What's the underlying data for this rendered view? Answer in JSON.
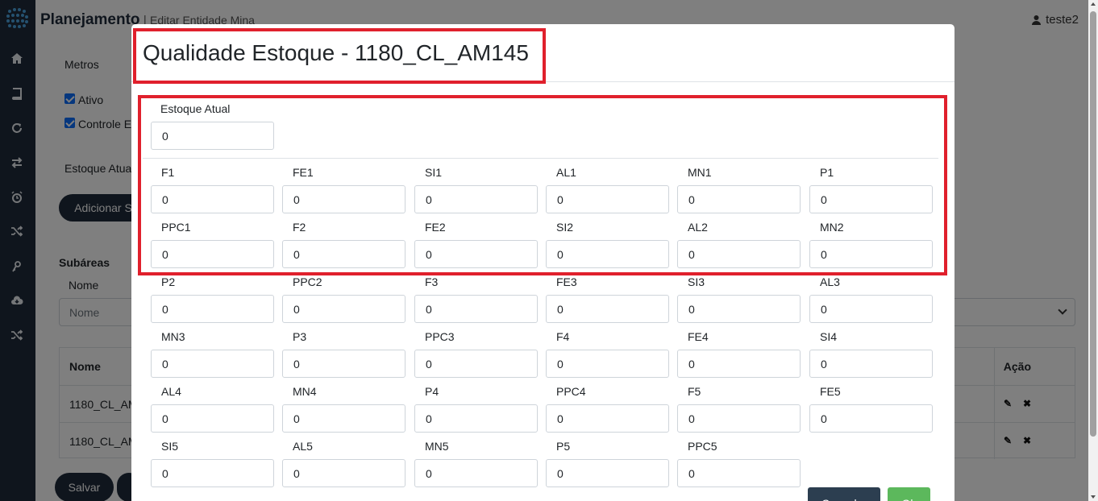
{
  "header": {
    "app_title": "Planejamento",
    "separator": "|",
    "breadcrumb": "Editar Entidade Mina",
    "user": "teste2"
  },
  "sidebar": {
    "icons": [
      "home-icon",
      "book-icon",
      "refresh-icon",
      "exchange-icon",
      "alarm-icon",
      "shuffle-icon",
      "key-icon",
      "cloud-download-icon",
      "random-icon"
    ]
  },
  "background": {
    "metros_label": "Metros",
    "ativo_label": "Ativo",
    "controle_label": "Controle E",
    "estoque_label": "Estoque Atua",
    "add_button": "Adicionar S",
    "subareas_heading": "Subáreas",
    "nome_label": "Nome",
    "nome_placeholder": "Nome",
    "table_header_nome": "Nome",
    "table_header_acao": "Ação",
    "rows": [
      "1180_CL_AM",
      "1180_CL_AM"
    ],
    "save_button": "Salvar"
  },
  "modal": {
    "title": "Qualidade Estoque - 1180_CL_AM145",
    "estoque_atual": {
      "label": "Estoque Atual",
      "value": "0"
    },
    "fields": [
      {
        "label": "F1",
        "value": "0"
      },
      {
        "label": "FE1",
        "value": "0"
      },
      {
        "label": "SI1",
        "value": "0"
      },
      {
        "label": "AL1",
        "value": "0"
      },
      {
        "label": "MN1",
        "value": "0"
      },
      {
        "label": "P1",
        "value": "0"
      },
      {
        "label": "PPC1",
        "value": "0"
      },
      {
        "label": "F2",
        "value": "0"
      },
      {
        "label": "FE2",
        "value": "0"
      },
      {
        "label": "SI2",
        "value": "0"
      },
      {
        "label": "AL2",
        "value": "0"
      },
      {
        "label": "MN2",
        "value": "0"
      },
      {
        "label": "P2",
        "value": "0"
      },
      {
        "label": "PPC2",
        "value": "0"
      },
      {
        "label": "F3",
        "value": "0"
      },
      {
        "label": "FE3",
        "value": "0"
      },
      {
        "label": "SI3",
        "value": "0"
      },
      {
        "label": "AL3",
        "value": "0"
      },
      {
        "label": "MN3",
        "value": "0"
      },
      {
        "label": "P3",
        "value": "0"
      },
      {
        "label": "PPC3",
        "value": "0"
      },
      {
        "label": "F4",
        "value": "0"
      },
      {
        "label": "FE4",
        "value": "0"
      },
      {
        "label": "SI4",
        "value": "0"
      },
      {
        "label": "AL4",
        "value": "0"
      },
      {
        "label": "MN4",
        "value": "0"
      },
      {
        "label": "P4",
        "value": "0"
      },
      {
        "label": "PPC4",
        "value": "0"
      },
      {
        "label": "F5",
        "value": "0"
      },
      {
        "label": "FE5",
        "value": "0"
      },
      {
        "label": "SI5",
        "value": "0"
      },
      {
        "label": "AL5",
        "value": "0"
      },
      {
        "label": "MN5",
        "value": "0"
      },
      {
        "label": "P5",
        "value": "0"
      },
      {
        "label": "PPC5",
        "value": "0"
      }
    ],
    "cancel_button": "Cancelar",
    "ok_button": "Ok"
  },
  "colors": {
    "sidebar": "#1f2a3a",
    "highlight": "#e0202c",
    "ok": "#5cb85c",
    "cancel": "#2c3e50"
  }
}
